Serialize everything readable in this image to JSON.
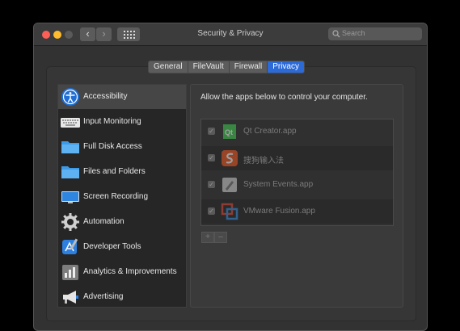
{
  "window": {
    "title": "Security & Privacy"
  },
  "toolbar": {
    "back": "‹",
    "forward": "›"
  },
  "search": {
    "placeholder": "Search"
  },
  "tabs": [
    {
      "label": "General",
      "active": false
    },
    {
      "label": "FileVault",
      "active": false
    },
    {
      "label": "Firewall",
      "active": false
    },
    {
      "label": "Privacy",
      "active": true
    }
  ],
  "sidebar": {
    "items": [
      {
        "label": "Accessibility",
        "icon": "accessibility-icon",
        "selected": true
      },
      {
        "label": "Input Monitoring",
        "icon": "keyboard-icon"
      },
      {
        "label": "Full Disk Access",
        "icon": "folder-icon"
      },
      {
        "label": "Files and Folders",
        "icon": "folder-icon"
      },
      {
        "label": "Screen Recording",
        "icon": "display-icon"
      },
      {
        "label": "Automation",
        "icon": "gear-icon"
      },
      {
        "label": "Developer Tools",
        "icon": "developer-tools-icon"
      },
      {
        "label": "Analytics & Improvements",
        "icon": "analytics-icon"
      },
      {
        "label": "Advertising",
        "icon": "megaphone-icon"
      }
    ]
  },
  "main": {
    "heading": "Allow the apps below to control your computer.",
    "apps": [
      {
        "name": "Qt Creator.app",
        "checked": true,
        "icon": "qt-creator-icon"
      },
      {
        "name": "搜狗输入法",
        "checked": true,
        "icon": "sogou-input-icon"
      },
      {
        "name": "System Events.app",
        "checked": true,
        "icon": "system-events-icon"
      },
      {
        "name": "VMware Fusion.app",
        "checked": true,
        "icon": "vmware-fusion-icon"
      }
    ],
    "add_label": "+",
    "remove_label": "–"
  },
  "colors": {
    "accent": "#2c6ad7",
    "close": "#fd5f57",
    "minimize": "#febc2e"
  }
}
